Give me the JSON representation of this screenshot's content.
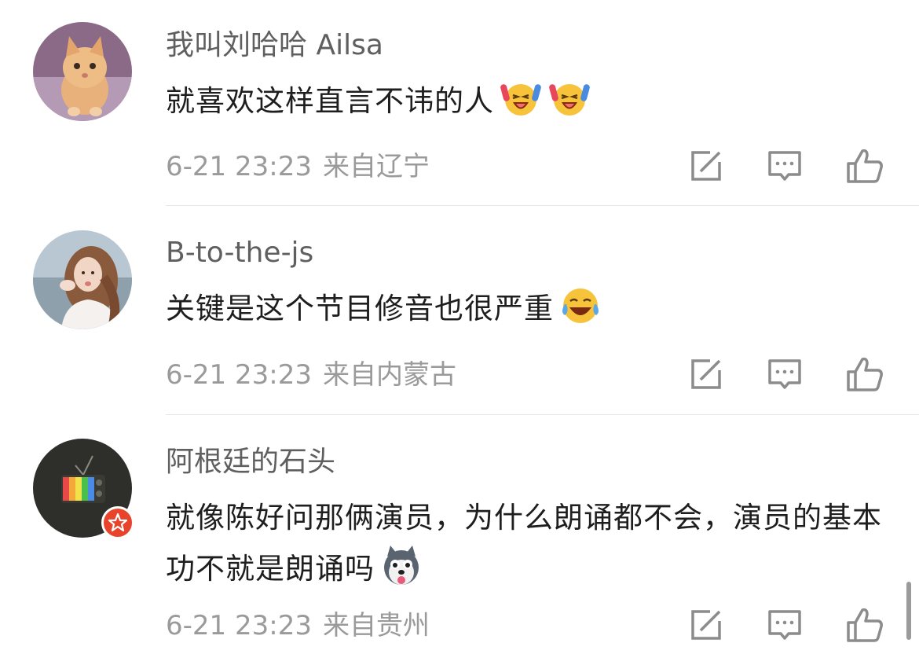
{
  "comments": [
    {
      "username": "我叫刘哈哈 Ailsa",
      "text": "就喜欢这样直言不讳的人",
      "emojis": [
        "laughing-hands-up-emoji",
        "laughing-hands-up-emoji"
      ],
      "date": "6-21 23:23",
      "location": "来自辽宁",
      "avatar": "kitten-photo"
    },
    {
      "username": "B-to-the-js",
      "text": "关键是这个节目修音也很严重",
      "emojis": [
        "tears-of-joy-emoji"
      ],
      "date": "6-21 23:23",
      "location": "来自内蒙古",
      "avatar": "woman-blowing-kiss-photo"
    },
    {
      "username": "阿根廷的石头",
      "text": "就像陈好问那俩演员，为什么朗诵都不会，演员的基本功不就是朗诵吗",
      "emojis": [
        "husky-dog-emoji"
      ],
      "date": "6-21 23:23",
      "location": "来自贵州",
      "avatar": "retro-tv-icon",
      "badge": "vip-star-badge"
    }
  ],
  "actions": [
    "forward-icon",
    "reply-comment-icon",
    "like-thumbs-up-icon"
  ],
  "colors": {
    "username": "#5f5f5f",
    "text": "#1e1e1e",
    "meta": "#9a9a9a",
    "icon": "#8c8c8c",
    "divider": "#e6e6e6",
    "badge": "#e8432b"
  }
}
